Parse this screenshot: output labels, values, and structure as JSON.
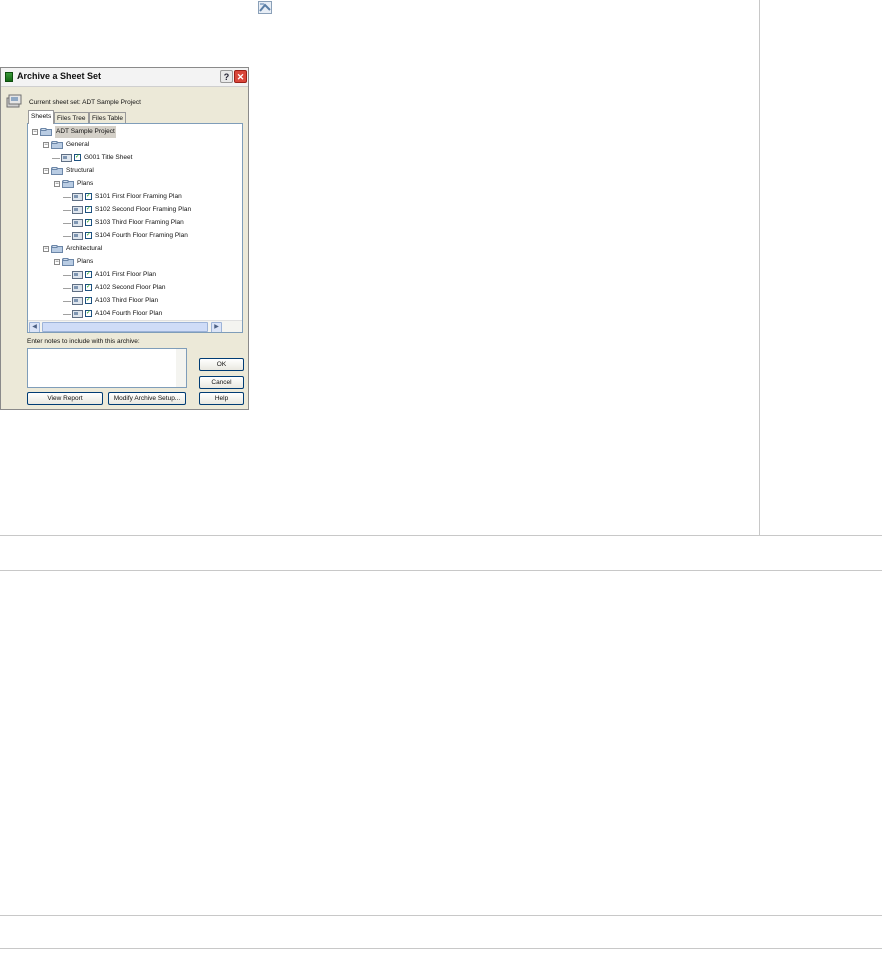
{
  "dialog": {
    "title": "Archive a Sheet Set",
    "help_glyph": "?",
    "close_glyph": "✕",
    "current_label": "Current sheet set: ADT Sample Project",
    "tabs": [
      {
        "label": "Sheets",
        "active": true
      },
      {
        "label": "Files Tree",
        "active": false
      },
      {
        "label": "Files Table",
        "active": false
      }
    ],
    "tree": [
      {
        "label": "ADT Sample Project",
        "kind": "root",
        "selected": true
      },
      {
        "label": "General",
        "kind": "subset"
      },
      {
        "label": "G001 Title Sheet",
        "kind": "sheet",
        "checked": true
      },
      {
        "label": "Structural",
        "kind": "subset"
      },
      {
        "label": "Plans",
        "kind": "subset"
      },
      {
        "label": "S101 First Floor Framing Plan",
        "kind": "sheet",
        "checked": true
      },
      {
        "label": "S102 Second Floor Framing Plan",
        "kind": "sheet",
        "checked": true
      },
      {
        "label": "S103 Third Floor Framing Plan",
        "kind": "sheet",
        "checked": true
      },
      {
        "label": "S104 Fourth Floor Framing Plan",
        "kind": "sheet",
        "checked": true
      },
      {
        "label": "Architectural",
        "kind": "subset"
      },
      {
        "label": "Plans",
        "kind": "subset"
      },
      {
        "label": "A101 First Floor Plan",
        "kind": "sheet",
        "checked": true
      },
      {
        "label": "A102 Second Floor Plan",
        "kind": "sheet",
        "checked": true
      },
      {
        "label": "A103 Third Floor Plan",
        "kind": "sheet",
        "checked": true
      },
      {
        "label": "A104 Fourth Floor Plan",
        "kind": "sheet",
        "checked": true
      }
    ],
    "notes_label": "Enter notes to include with this archive:",
    "notes_value": "",
    "buttons": {
      "ok": "OK",
      "cancel": "Cancel",
      "help": "Help",
      "view_report": "View Report",
      "modify_setup": "Modify Archive Setup..."
    },
    "colors": {
      "title_accent": "#1f7a1f",
      "close": "#d9463a",
      "checkmark": "#21a121"
    }
  }
}
